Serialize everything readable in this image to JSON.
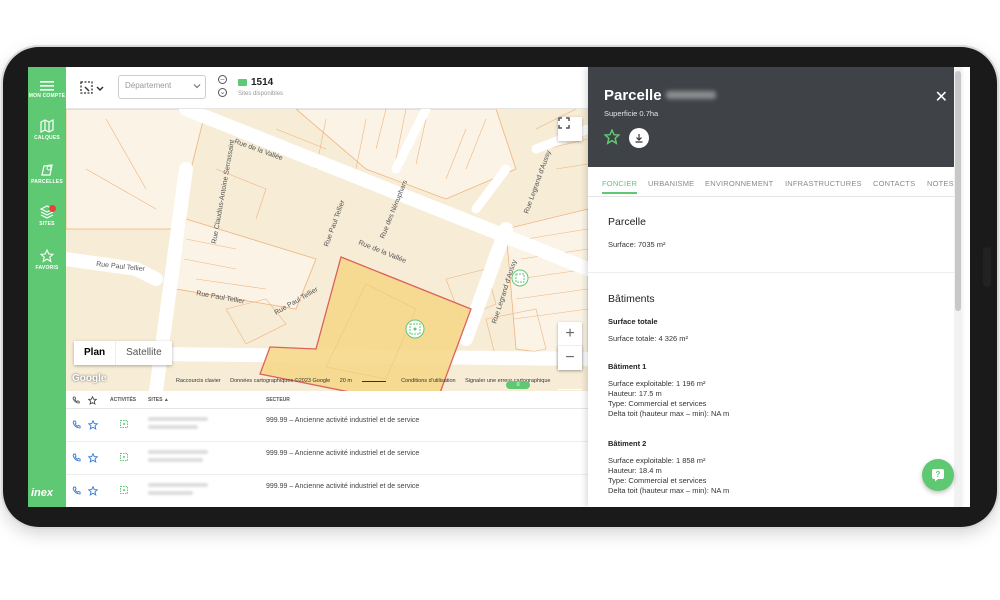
{
  "sidebar": {
    "items": [
      {
        "label": "MON COMPTE",
        "icon": "menu-icon"
      },
      {
        "label": "CALQUES",
        "icon": "map-icon"
      },
      {
        "label": "PARCELLES",
        "icon": "parcel-icon"
      },
      {
        "label": "SITES",
        "icon": "layers-icon"
      },
      {
        "label": "FAVORIS",
        "icon": "star-icon"
      }
    ],
    "logo": "inex"
  },
  "toolbar": {
    "department_placeholder": "Département",
    "site_count": "1514",
    "site_count_label": "Sites disponibles"
  },
  "map": {
    "streets": {
      "vallee_1": "Rue de la Vallée",
      "vallee_2": "Rue de la Vallée",
      "serrassaint": "Rue Claudius-Antoine Serrassaint",
      "nenuphars": "Rue des Nénuphars",
      "legrand_1": "Rue Legrand d'Aussy",
      "legrand_2": "Rue Legrand d'Aussy",
      "tellier_1": "Rue Paul Tellier",
      "tellier_2": "Rue Paul Tellier",
      "tellier_3": "Rue Paul Tellier",
      "tellier_4": "Rue Paul Tellier"
    },
    "map_type_plan": "Plan",
    "map_type_satellite": "Satellite",
    "google_logo": "Google",
    "attribution": {
      "shortcuts": "Raccourcis clavier",
      "data": "Données cartographiques ©2023 Google",
      "scale": "20 m",
      "terms": "Conditions d'utilisation",
      "report": "Signaler une erreur cartographique"
    },
    "zoom_in": "+",
    "zoom_out": "−"
  },
  "table": {
    "headers": {
      "activities": "ACTIVITÉS",
      "sites": "SITES ▲",
      "sector": "SECTEUR"
    },
    "rows": [
      {
        "sector": "999.99 – Ancienne activité industriel et de service"
      },
      {
        "sector": "999.99 – Ancienne activité industriel et de service"
      },
      {
        "sector": "999.99 – Ancienne activité industriel et de service"
      }
    ]
  },
  "panel": {
    "title": "Parcelle",
    "subtitle": "Superficie 0.7ha",
    "close": "✕",
    "tabs": [
      "FONCIER",
      "URBANISME",
      "ENVIRONNEMENT",
      "INFRASTRUCTURES",
      "CONTACTS",
      "NOTES"
    ],
    "active_tab": "FONCIER",
    "parcelle": {
      "heading": "Parcelle",
      "surface": "Surface: 7035 m²"
    },
    "batiments": {
      "heading": "Bâtiments",
      "total_label": "Surface totale",
      "total_value": "Surface totale: 4 326 m²",
      "b1": {
        "name": "Bâtiment 1",
        "surface": "Surface exploitable: 1 196 m²",
        "hauteur": "Hauteur: 17.5 m",
        "type": "Type: Commercial et services",
        "delta": "Delta toit (hauteur max – min): NA m"
      },
      "b2": {
        "name": "Bâtiment 2",
        "surface": "Surface exploitable: 1 858 m²",
        "hauteur": "Hauteur: 18.4 m",
        "type": "Type: Commercial et services",
        "delta": "Delta toit (hauteur max – min): NA m"
      }
    }
  },
  "colors": {
    "accent": "#5fc873",
    "panel_header": "#3f4347",
    "parcel_fill": "#f6d98a",
    "parcel_stroke": "#d9534f",
    "map_bg": "#f7ecd6"
  }
}
